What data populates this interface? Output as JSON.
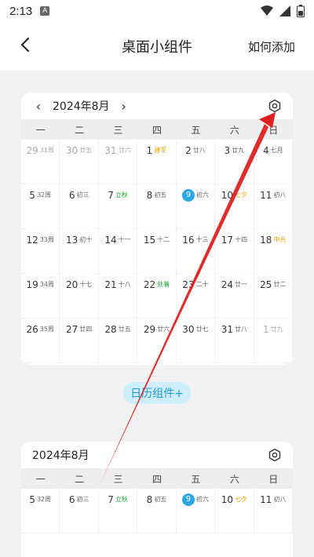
{
  "status": {
    "time": "2:13",
    "notif_letter": "A"
  },
  "nav": {
    "title": "桌面小组件",
    "howto": "如何添加"
  },
  "card1": {
    "month": "2024年8月",
    "prev_arrow": "‹",
    "next_arrow": "›",
    "weekdays": [
      "一",
      "二",
      "三",
      "四",
      "五",
      "六",
      "日"
    ],
    "days": [
      {
        "d": "29",
        "l": "31周",
        "c": "other"
      },
      {
        "d": "30",
        "l": "廿五",
        "c": "other"
      },
      {
        "d": "31",
        "l": "廿六",
        "c": "other"
      },
      {
        "d": "1",
        "l": "建军",
        "c": "orange"
      },
      {
        "d": "2",
        "l": "廿八",
        "c": ""
      },
      {
        "d": "3",
        "l": "廿九",
        "c": ""
      },
      {
        "d": "4",
        "l": "七月",
        "c": ""
      },
      {
        "d": "5",
        "l": "32周",
        "c": ""
      },
      {
        "d": "6",
        "l": "初三",
        "c": ""
      },
      {
        "d": "7",
        "l": "立秋",
        "c": "green"
      },
      {
        "d": "8",
        "l": "初五",
        "c": ""
      },
      {
        "d": "9",
        "l": "初六",
        "c": "today"
      },
      {
        "d": "10",
        "l": "七夕",
        "c": "orange"
      },
      {
        "d": "11",
        "l": "初八",
        "c": ""
      },
      {
        "d": "12",
        "l": "33周",
        "c": ""
      },
      {
        "d": "13",
        "l": "初十",
        "c": ""
      },
      {
        "d": "14",
        "l": "十一",
        "c": ""
      },
      {
        "d": "15",
        "l": "十二",
        "c": ""
      },
      {
        "d": "16",
        "l": "十三",
        "c": ""
      },
      {
        "d": "17",
        "l": "十四",
        "c": ""
      },
      {
        "d": "18",
        "l": "中元",
        "c": "orange"
      },
      {
        "d": "19",
        "l": "34周",
        "c": ""
      },
      {
        "d": "20",
        "l": "十七",
        "c": ""
      },
      {
        "d": "21",
        "l": "十八",
        "c": ""
      },
      {
        "d": "22",
        "l": "处暑",
        "c": "green"
      },
      {
        "d": "23",
        "l": "二十",
        "c": ""
      },
      {
        "d": "24",
        "l": "廿一",
        "c": ""
      },
      {
        "d": "25",
        "l": "廿二",
        "c": ""
      },
      {
        "d": "26",
        "l": "35周",
        "c": ""
      },
      {
        "d": "27",
        "l": "廿四",
        "c": ""
      },
      {
        "d": "28",
        "l": "廿五",
        "c": ""
      },
      {
        "d": "29",
        "l": "廿六",
        "c": ""
      },
      {
        "d": "30",
        "l": "廿七",
        "c": ""
      },
      {
        "d": "31",
        "l": "廿八",
        "c": ""
      },
      {
        "d": "1",
        "l": "廿九",
        "c": "other"
      }
    ]
  },
  "add_button": "日历组件+",
  "card2": {
    "month": "2024年8月",
    "weekdays": [
      "一",
      "二",
      "三",
      "四",
      "五",
      "六",
      "日"
    ],
    "days": [
      {
        "d": "5",
        "l": "32周",
        "c": ""
      },
      {
        "d": "6",
        "l": "初三",
        "c": ""
      },
      {
        "d": "7",
        "l": "立秋",
        "c": "green"
      },
      {
        "d": "8",
        "l": "初五",
        "c": ""
      },
      {
        "d": "9",
        "l": "初六",
        "c": "today"
      },
      {
        "d": "10",
        "l": "七夕",
        "c": "orange"
      },
      {
        "d": "11",
        "l": "初八",
        "c": ""
      }
    ]
  },
  "colors": {
    "accent": "#2aa8e6",
    "green": "#19a33a",
    "orange": "#f0a000",
    "arrow": "#e02020"
  }
}
